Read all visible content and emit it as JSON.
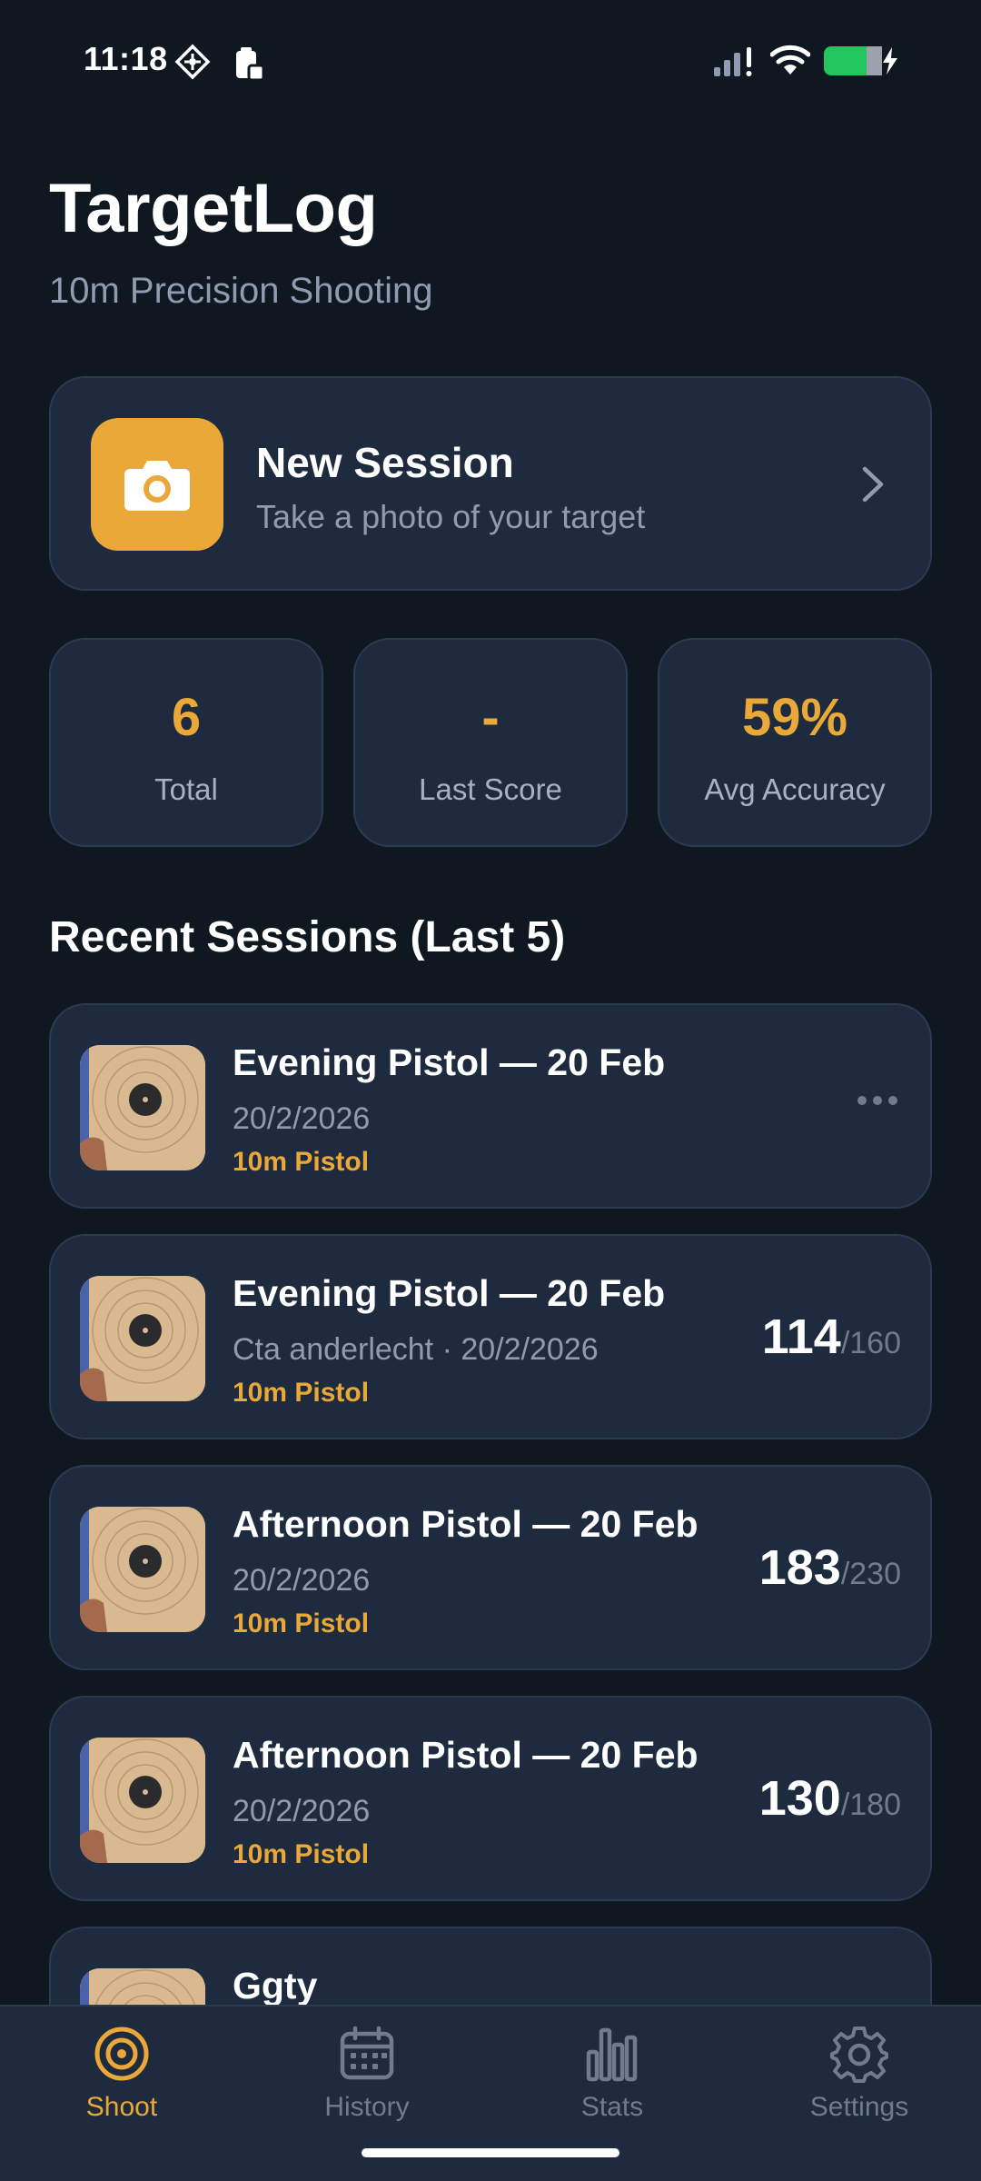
{
  "status_bar": {
    "time": "11:18",
    "icons": [
      "nfc-icon",
      "clipboard-lock-icon",
      "signal-icon",
      "wifi-icon",
      "battery-charging-icon"
    ]
  },
  "header": {
    "title": "TargetLog",
    "subtitle": "10m Precision Shooting"
  },
  "new_session": {
    "title": "New Session",
    "subtitle": "Take a photo of your target",
    "icon": "camera-icon"
  },
  "stats": [
    {
      "value": "6",
      "label": "Total"
    },
    {
      "value": "-",
      "label": "Last Score"
    },
    {
      "value": "59%",
      "label": "Avg Accuracy"
    }
  ],
  "recent": {
    "title": "Recent Sessions (Last 5)",
    "sessions": [
      {
        "title": "Evening Pistol — 20 Feb",
        "meta": "20/2/2026",
        "tag": "10m Pistol",
        "score": "",
        "max": "",
        "pending": true
      },
      {
        "title": "Evening Pistol — 20 Feb",
        "meta": "Cta anderlecht · 20/2/2026",
        "tag": "10m Pistol",
        "score": "114",
        "max": "/160"
      },
      {
        "title": "Afternoon Pistol — 20 Feb",
        "meta": "20/2/2026",
        "tag": "10m Pistol",
        "score": "183",
        "max": "/230"
      },
      {
        "title": "Afternoon Pistol — 20 Feb",
        "meta": "20/2/2026",
        "tag": "10m Pistol",
        "score": "130",
        "max": "/180"
      },
      {
        "title": "Ggty",
        "meta": "",
        "tag": "",
        "score": "",
        "max": ""
      }
    ]
  },
  "tabs": [
    {
      "label": "Shoot",
      "icon": "target-icon",
      "active": true
    },
    {
      "label": "History",
      "icon": "calendar-icon",
      "active": false
    },
    {
      "label": "Stats",
      "icon": "bar-chart-icon",
      "active": false
    },
    {
      "label": "Settings",
      "icon": "gear-icon",
      "active": false
    }
  ],
  "colors": {
    "background": "#0f1721",
    "card": "#1e2b3e",
    "accent": "#eaa838",
    "muted": "#8f9bb0"
  }
}
